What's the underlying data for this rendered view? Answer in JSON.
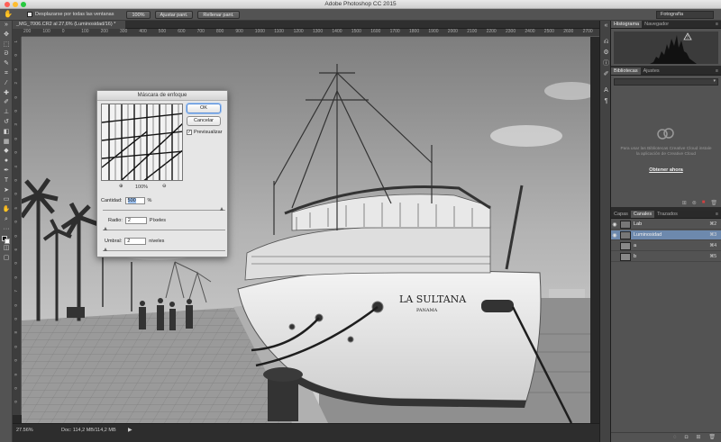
{
  "window": {
    "title": "Adobe Photoshop CC 2015"
  },
  "options_bar": {
    "scroll_all_label": "Desplazarse por todas las ventanas",
    "zoom_100_label": "100%",
    "fit_screen_label": "Ajustar pant.",
    "fill_screen_label": "Rellenar pant.",
    "workspace_label": "Fotografía"
  },
  "document": {
    "tab_label": "_MG_7006.CR2 al 27,6% (Luminosidad/16) *",
    "ruler_h": [
      "200",
      "100",
      "0",
      "100",
      "200",
      "300",
      "400",
      "500",
      "600",
      "700",
      "800",
      "900",
      "1000",
      "1100",
      "1200",
      "1300",
      "1400",
      "1500",
      "1600",
      "1700",
      "1800",
      "1900",
      "2000",
      "2100",
      "2200",
      "2300",
      "2400",
      "2500",
      "2600",
      "2700"
    ],
    "ruler_v": [
      "1",
      "0",
      "0",
      "2",
      "0",
      "0",
      "3",
      "0",
      "0",
      "4",
      "0",
      "0",
      "5",
      "0",
      "0",
      "6",
      "0",
      "0",
      "7",
      "0",
      "0",
      "8",
      "0",
      "0",
      "9",
      "0",
      "0"
    ],
    "ship_name": "LA SULTANA",
    "ship_port": "PANAMA"
  },
  "status_bar": {
    "zoom": "27.56%",
    "doc_info": "Doc: 114,2 MB/114,2 MB",
    "arrow": "▶"
  },
  "dialog": {
    "title": "Máscara de enfoque",
    "ok_label": "OK",
    "cancel_label": "Cancelar",
    "preview_label": "Previsualizar",
    "preview_checked": "✓",
    "zoom_pct": "100%",
    "amount_label": "Cantidad:",
    "amount_value": "500",
    "amount_unit": "%",
    "radius_label": "Radio:",
    "radius_value": "2",
    "radius_unit": "Píxeles",
    "threshold_label": "Umbral:",
    "threshold_value": "2",
    "threshold_unit": "niveles",
    "amount_fraction": 0.99,
    "radius_fraction": 0.01,
    "threshold_fraction": 0.01
  },
  "panels": {
    "histogram_tab": "Histograma",
    "navigator_tab": "Navegador",
    "warning_icon": "!",
    "libraries_tab": "Bibliotecas",
    "adjustments_tab": "Ajustes",
    "libraries_msg": "Para usar las Bibliotecas Creative Cloud instale la aplicación de Creative Cloud",
    "libraries_link": "Obtener ahora",
    "layers_tab": "Capas",
    "channels_tab": "Canales",
    "paths_tab": "Trazados",
    "panel_menu": "≡",
    "channels": [
      {
        "name": "Lab",
        "shortcut": "⌘2",
        "visible": true
      },
      {
        "name": "Luminosidad",
        "shortcut": "⌘3",
        "visible": true
      },
      {
        "name": "a",
        "shortcut": "⌘4",
        "visible": false
      },
      {
        "name": "b",
        "shortcut": "⌘5",
        "visible": false
      }
    ]
  }
}
